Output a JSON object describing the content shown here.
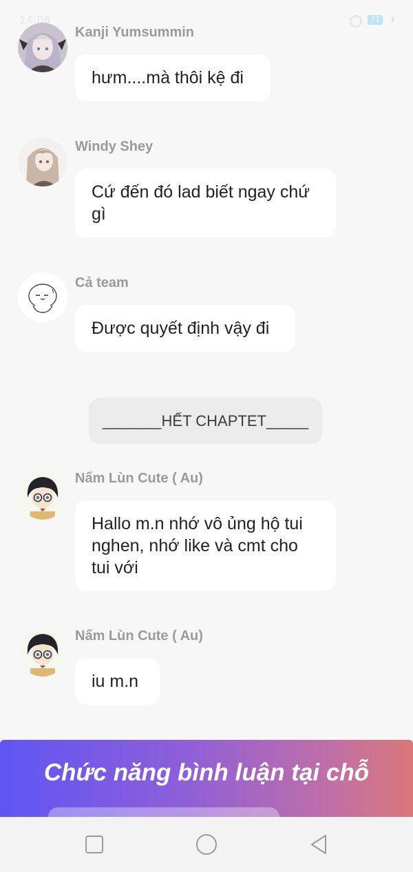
{
  "status_bar": {
    "time": "14:08",
    "battery": "71"
  },
  "messages": [
    {
      "sender": "Kanji Yumsummin",
      "text": "hưm....mà thôi kệ đi"
    },
    {
      "sender": "Windy Shey",
      "text": "Cứ đến đó lad biết ngay chứ gì"
    },
    {
      "sender": "Cả team",
      "text": "Được quyết định vậy đi"
    },
    {
      "sender": "Nấm Lùn Cute ( Au)",
      "text": "Hallo m.n nhớ vô ủng hộ tui nghen, nhớ like và cmt cho tui với"
    },
    {
      "sender": "Nấm Lùn Cute ( Au)",
      "text": "iu m.n"
    }
  ],
  "divider_text": "_______HẾT CHAPTET_____",
  "banner": {
    "title": "Chức năng bình luận tại chỗ"
  },
  "nav": {
    "recent_icon": "square-icon",
    "home_icon": "circle-icon",
    "back_icon": "triangle-back-icon"
  },
  "colors": {
    "background": "#f7f7f7",
    "bubble": "#ffffff",
    "sender_text": "#9a9a9a",
    "banner_start": "#5f55f4",
    "banner_end": "#d9787a"
  }
}
